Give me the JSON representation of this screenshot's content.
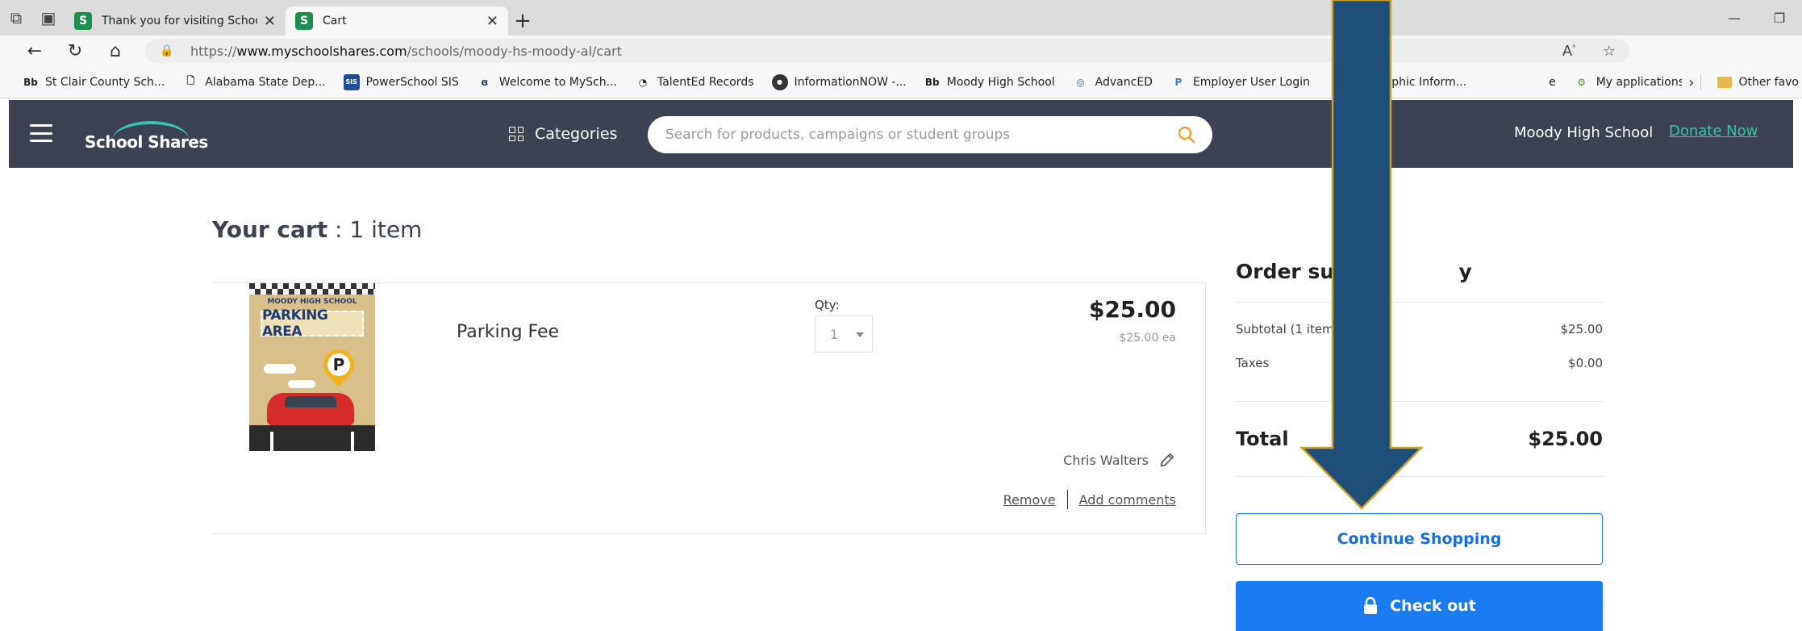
{
  "browser": {
    "tabs": [
      {
        "favicon": "S",
        "title": "Thank you for visiting School Sha",
        "active": false
      },
      {
        "favicon": "S",
        "title": "Cart",
        "active": true
      }
    ],
    "url": {
      "prefix": "https://",
      "host": "www.myschoolshares.com",
      "path": "/schools/moody-hs-moody-al/cart"
    },
    "favorites": [
      {
        "icon": "Bb",
        "label": "St Clair County Sch..."
      },
      {
        "icon": "page-icon",
        "label": "Alabama State Dep..."
      },
      {
        "icon": "SIS",
        "label": "PowerSchool SIS"
      },
      {
        "icon": "B",
        "label": "Welcome to MySch..."
      },
      {
        "icon": "TE",
        "label": "TalentEd Records"
      },
      {
        "icon": "IN",
        "label": "InformationNOW -..."
      },
      {
        "icon": "Bb",
        "label": "Moody High School"
      },
      {
        "icon": "AE",
        "label": "AdvancED"
      },
      {
        "icon": "P",
        "label": "Employer User Login"
      },
      {
        "icon": "G",
        "label": "Geographic Inform..."
      },
      {
        "icon": "",
        "label": "e"
      },
      {
        "icon": "gear",
        "label": "My applications « (..."
      }
    ],
    "other_favorites": "Other favo"
  },
  "header": {
    "logo_text": "School Shares",
    "categories_label": "Categories",
    "search_placeholder": "Search for products, campaigns or student groups",
    "school_name": "Moody High School",
    "donate_label": "Donate Now"
  },
  "cart": {
    "title_bold": "Your cart",
    "title_rest": " : 1 item",
    "item": {
      "image_school_text": "MOODY HIGH SCHOOL",
      "image_banner_text": "PARKING AREA",
      "image_pin_text": "P",
      "name": "Parking Fee",
      "qty_label": "Qty:",
      "qty_value": "1",
      "price": "$25.00",
      "price_each": "$25.00 ea",
      "recipient": "Chris Walters",
      "remove_label": "Remove",
      "comments_label": "Add comments"
    }
  },
  "summary": {
    "title": "Order sur",
    "title_tail": "y",
    "subtotal_label": "Subtotal (1 item",
    "subtotal_value": "$25.00",
    "taxes_label": "Taxes",
    "taxes_value": "$0.00",
    "total_label": "Total",
    "total_value": "$25.00",
    "continue_label": "Continue Shopping",
    "checkout_label": "Check out"
  },
  "colors": {
    "header_bg": "#3c4253",
    "accent_blue": "#1a7bf2",
    "donate_green": "#37c7a5",
    "arrow_fill": "#1f4e79",
    "arrow_border": "#c9a227"
  }
}
